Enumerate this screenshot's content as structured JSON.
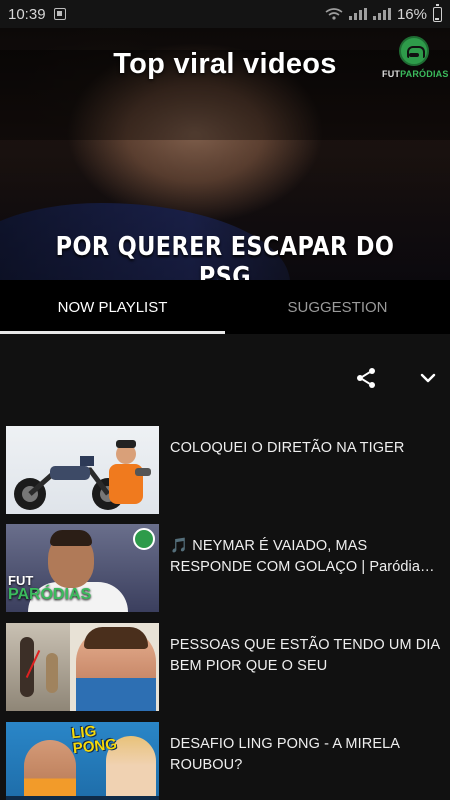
{
  "status_bar": {
    "time": "10:39",
    "battery": "16%"
  },
  "hero": {
    "title": "Top viral videos",
    "caption": "POR QUERER ESCAPAR DO PSG",
    "logo": {
      "part1": "FUT",
      "part2": "PARÓDIAS"
    }
  },
  "tabs": [
    {
      "label": "NOW PLAYLIST",
      "active": true
    },
    {
      "label": "SUGGESTION",
      "active": false
    }
  ],
  "actions": {
    "share_icon": "share-icon",
    "collapse_icon": "chevron-down-icon"
  },
  "playlist": [
    {
      "title": "COLOQUEI O DIRETÃO NA TIGER"
    },
    {
      "title": "🎵 NEYMAR É VAIADO, MAS RESPONDE COM GOLAÇO | Paródia Grenade - Bru..."
    },
    {
      "title": "PESSOAS QUE ESTÃO TENDO UM DIA BEM PIOR QUE O SEU"
    },
    {
      "title": "DESAFIO LING PONG - A MIRELA ROUBOU?"
    }
  ],
  "thumb_labels": {
    "fut": "FUT",
    "parodias": "PARÓDIAS",
    "lig": "LIG",
    "pong": "PONG"
  },
  "colors": {
    "background": "#111111",
    "tab_bar": "#000000",
    "accent_green": "#2e9b4a"
  }
}
